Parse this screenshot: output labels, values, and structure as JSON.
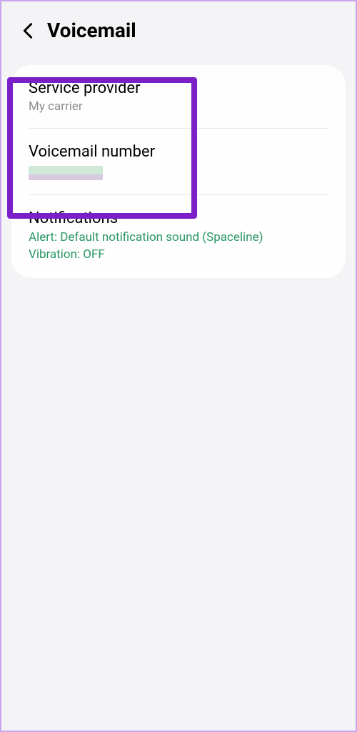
{
  "header": {
    "title": "Voicemail"
  },
  "settings": {
    "serviceProvider": {
      "title": "Service provider",
      "value": "My carrier"
    },
    "voicemailNumber": {
      "title": "Voicemail number"
    },
    "notifications": {
      "title": "Notifications",
      "alert": "Alert: Default notification sound (Spaceline)",
      "vibration": "Vibration: OFF"
    }
  }
}
